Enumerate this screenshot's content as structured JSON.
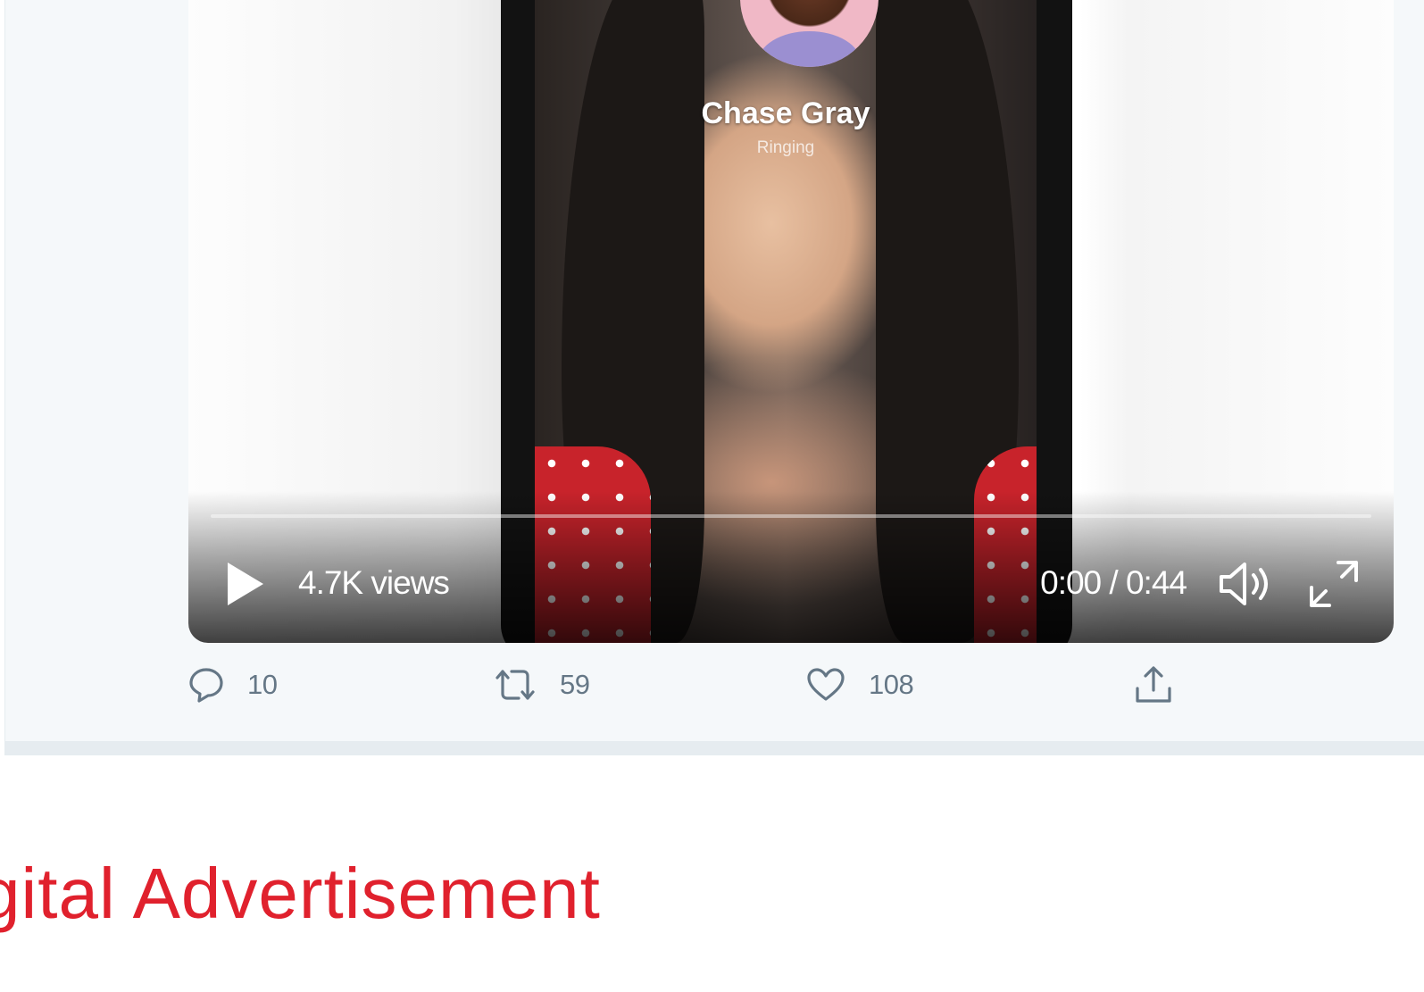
{
  "video": {
    "caller_name": "Chase Gray",
    "caller_status": "Ringing",
    "views": "4.7K views",
    "time": "0:00 / 0:44",
    "progress_fraction": 0
  },
  "actions": {
    "replies": "10",
    "retweets": "59",
    "likes": "108"
  },
  "headline": "gital Advertisement",
  "colors": {
    "headline": "#e0212d",
    "icon": "#657786"
  }
}
